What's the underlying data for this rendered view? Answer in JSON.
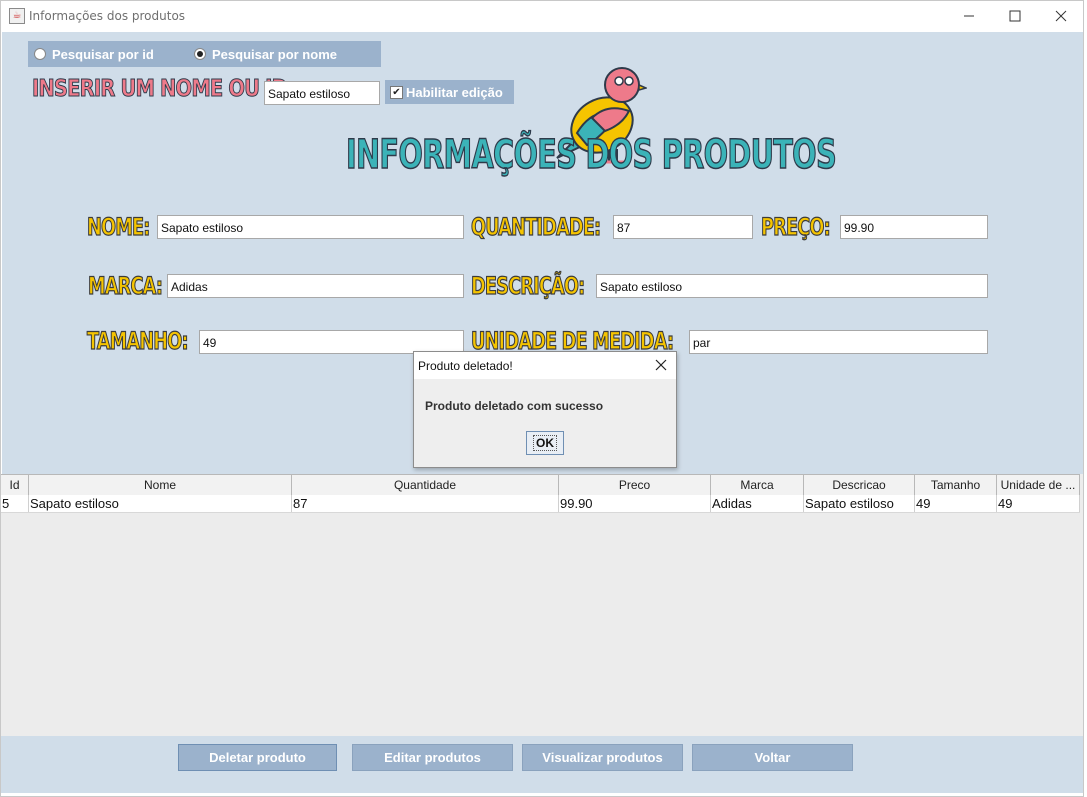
{
  "window": {
    "title": "Informações dos produtos",
    "app_icon": "java-cup-icon"
  },
  "search": {
    "radio_id": "Pesquisar por id",
    "radio_name": "Pesquisar por nome",
    "selected": "Pesquisar por nome",
    "insert_label": "INSERIR UM NOME OU ID:",
    "query_value": "Sapato estiloso",
    "enable_edit_label": "Habilitar edição",
    "enable_edit_checked": true
  },
  "header": {
    "title": "INFORMAÇÕES DOS PRODUTOS",
    "mascot": "colorful-bird-illustration"
  },
  "form": {
    "nome_label": "NOME:",
    "nome_value": "Sapato estiloso",
    "quantidade_label": "QUANTIDADE:",
    "quantidade_value": "87",
    "preco_label": "PREÇO:",
    "preco_value": "99.90",
    "marca_label": "MARCA:",
    "marca_value": "Adidas",
    "descricao_label": "DESCRIÇÃO:",
    "descricao_value": "Sapato estiloso",
    "tamanho_label": "TAMANHO:",
    "tamanho_value": "49",
    "unidade_label": "UNIDADE DE MEDIDA:",
    "unidade_value": "par"
  },
  "table": {
    "headers": [
      "Id",
      "Nome",
      "Quantidade",
      "Preco",
      "Marca",
      "Descricao",
      "Tamanho",
      "Unidade de ..."
    ],
    "rows": [
      [
        "5",
        "Sapato estiloso",
        "87",
        "99.90",
        "Adidas",
        "Sapato estiloso",
        "49",
        "49"
      ]
    ]
  },
  "buttons": {
    "delete": "Deletar produto",
    "edit": "Editar produtos",
    "view": "Visualizar produtos",
    "back": "Voltar"
  },
  "dialog": {
    "title": "Produto deletado!",
    "message": "Produto deletado com sucesso",
    "ok": "OK"
  },
  "colors": {
    "panel_bg": "#d0dde9",
    "control_blue": "#9bb2cc",
    "label_yellow": "#f5c400",
    "label_pink": "#ee7a8a",
    "label_teal": "#3bb3b8"
  }
}
